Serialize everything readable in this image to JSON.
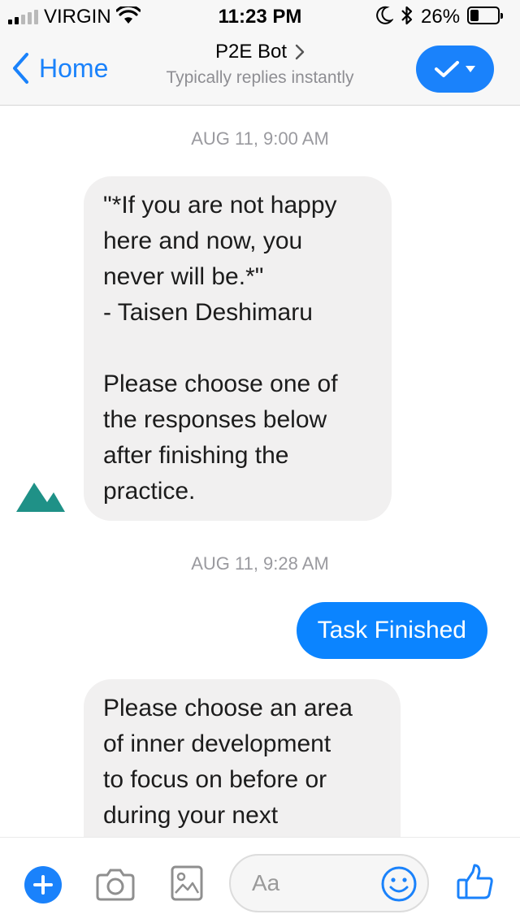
{
  "status_bar": {
    "carrier": "VIRGIN",
    "time": "11:23 PM",
    "battery_pct": "26%",
    "battery_level": 0.26,
    "signal_bars_total": 5,
    "signal_bars_filled": 2,
    "icons": [
      "signal-icon",
      "wifi-icon",
      "moon-icon",
      "bluetooth-icon",
      "battery-icon"
    ]
  },
  "nav": {
    "back_label": "Home",
    "title": "P2E Bot",
    "subtitle": "Typically replies instantly",
    "icons": [
      "back-chevron-icon",
      "chevron-right-icon",
      "check-icon",
      "caret-down-icon"
    ],
    "accent_color": "#1a82fb"
  },
  "chat": {
    "timestamp_1": "AUG 11, 9:00 AM",
    "message_1": "\"*If you are not happy\nhere and now, you\nnever will be.*\"\n- Taisen Deshimaru\n\nPlease choose one of\nthe responses below\nafter finishing the\npractice.",
    "timestamp_2": "AUG 11, 9:28 AM",
    "reply_1": "Task Finished",
    "message_2": "Please choose an area\nof inner development\nto focus on before or\nduring your next",
    "bot_avatar_icon": "mountain-icon",
    "incoming_bubble_color": "#f1f0f0",
    "outgoing_bubble_color": "#0b84ff"
  },
  "composer": {
    "placeholder": "Aa",
    "icons": [
      "plus-icon",
      "camera-icon",
      "gallery-icon",
      "emoji-icon",
      "thumbs-up-icon"
    ]
  }
}
